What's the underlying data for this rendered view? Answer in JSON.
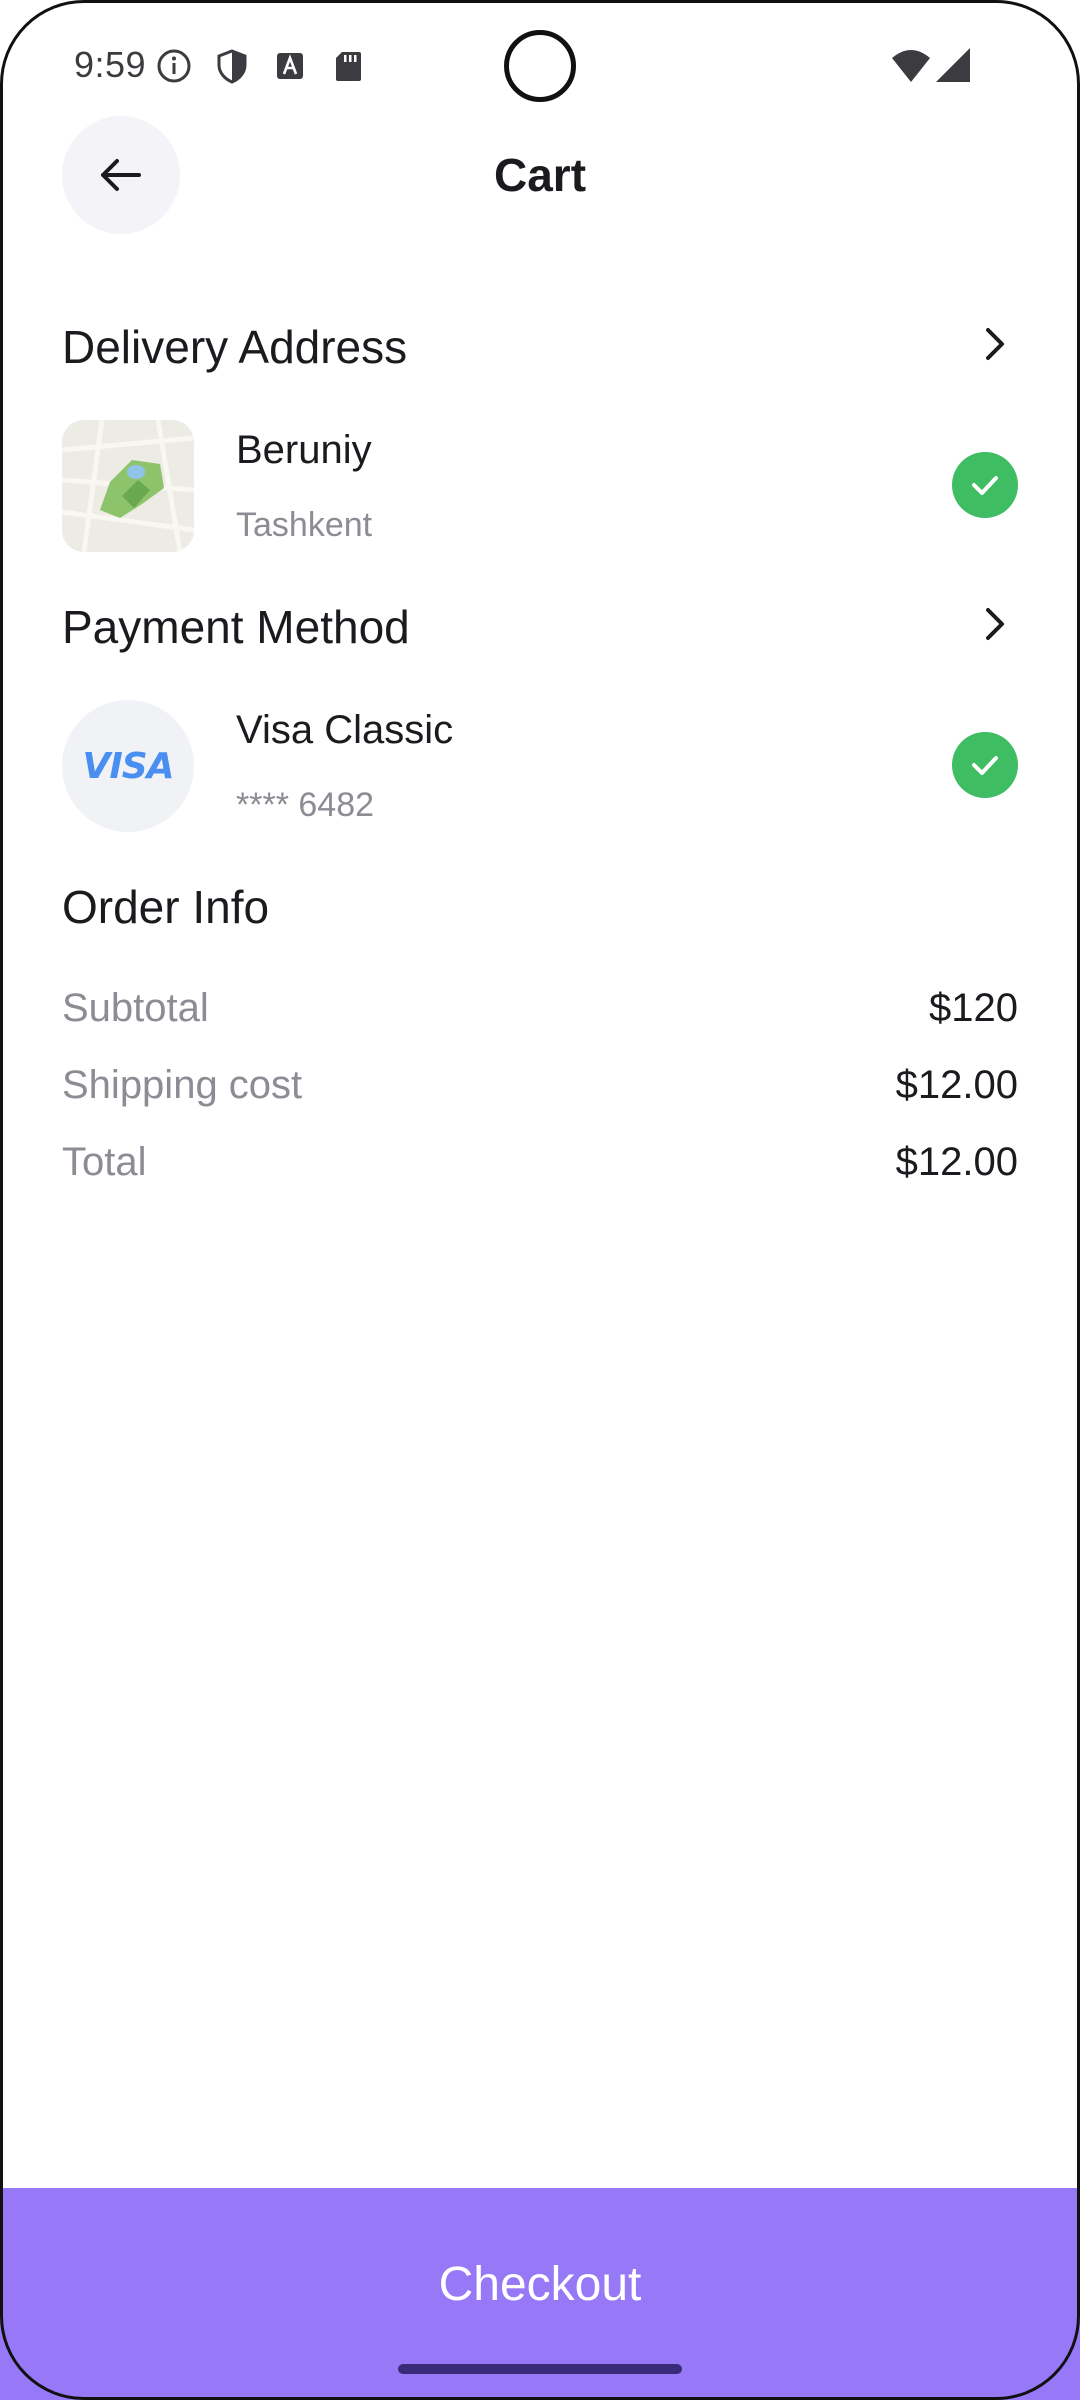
{
  "status_bar": {
    "time": "9:59",
    "icons": [
      "info-icon",
      "shield-icon",
      "text-a-icon",
      "sd-card-icon",
      "wifi-icon",
      "signal-icon"
    ]
  },
  "header": {
    "back_icon": "arrow-left-icon",
    "title": "Cart"
  },
  "delivery": {
    "title": "Delivery Address",
    "name": "Beruniy",
    "city": "Tashkent",
    "thumb_icon": "map-thumbnail",
    "selected": true
  },
  "payment": {
    "title": "Payment Method",
    "card_brand": "VISA",
    "card_name": "Visa Classic",
    "card_number": "**** 6482",
    "selected": true
  },
  "order_info": {
    "title": "Order Info",
    "rows": [
      {
        "label": "Subtotal",
        "value": "$120"
      },
      {
        "label": "Shipping cost",
        "value": "$12.00"
      },
      {
        "label": "Total",
        "value": "$12.00"
      }
    ]
  },
  "checkout": {
    "label": "Checkout"
  },
  "colors": {
    "accent": "#9778f7",
    "check_green": "#3ebd63",
    "muted_text": "#8c8c94",
    "visa_blue": "#4a8ef0"
  }
}
